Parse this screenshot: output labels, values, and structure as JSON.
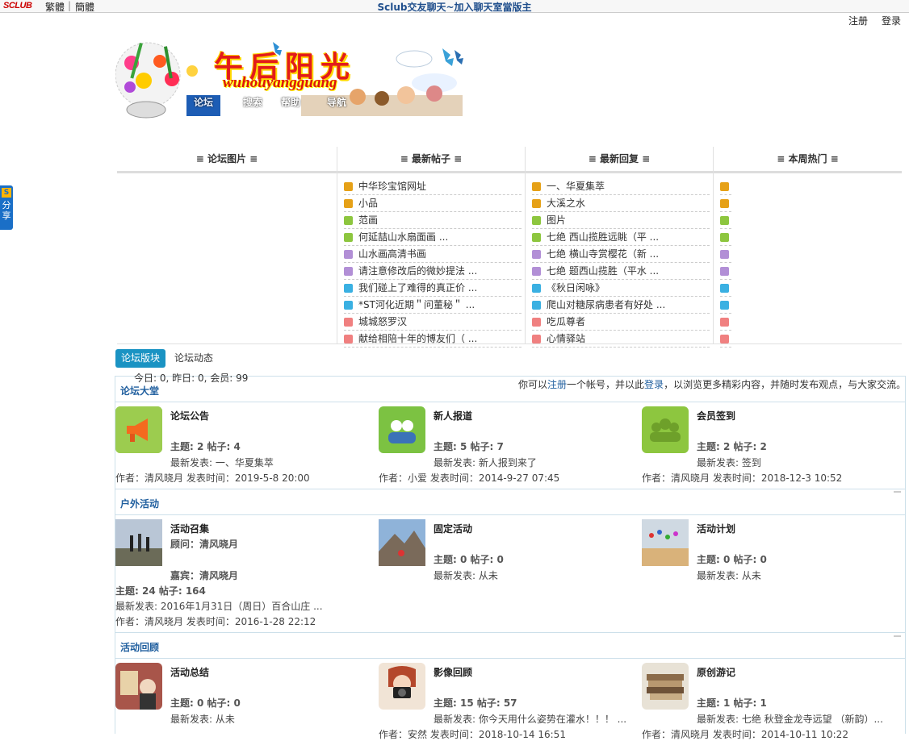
{
  "topbar": {
    "logo_text": "SCLUB",
    "traditional": "繁體",
    "separator": "|",
    "simplified": "簡體",
    "site_title": "Sclub交友聊天~加入聊天室當版主",
    "register": "注册",
    "login": "登录"
  },
  "banner": {
    "name": "午后阳光",
    "subtitle": "wuhouyangguang",
    "nav": [
      "论坛",
      "搜索",
      "帮助",
      "导航"
    ]
  },
  "share": {
    "badge": "S",
    "label": "分享"
  },
  "hot": {
    "columns": [
      {
        "title": "≡ 论坛图片 ≡",
        "items": []
      },
      {
        "title": "≡ 最新帖子 ≡",
        "items": [
          "中华珍宝馆网址",
          "小品",
          "范画",
          "何延喆山水扇面画 ...",
          "山水画高清书画",
          "请注意修改后的微妙提法 ...",
          "我们碰上了难得的真正价 ...",
          "*ST河化近期＂问董秘＂ ...",
          "城城怒罗汉",
          "献给相陪十年的博友们（ ..."
        ]
      },
      {
        "title": "≡ 最新回复 ≡",
        "items": [
          "一、华夏集萃",
          "大溪之水",
          "图片",
          "七绝 西山揽胜远眺（平 ...",
          "七绝 横山寺赏樱花（新 ...",
          "七绝 题西山揽胜（平水 ...",
          "《秋日闲咏》",
          "爬山对糖尿病患者有好处 ...",
          "吃瓜尊者",
          "心情驿站"
        ]
      },
      {
        "title": "≡ 本周热门 ≡",
        "items": [
          "",
          "",
          "",
          "",
          "",
          "",
          "",
          "",
          "",
          ""
        ]
      }
    ]
  },
  "forum_tabs": {
    "active": "论坛版块",
    "other": "论坛动态"
  },
  "stats": "今日: 0, 昨日: 0, 会员: 99",
  "welcome": {
    "pre": "你可以",
    "register": "注册",
    "mid": "一个帐号，并以此",
    "login": "登录",
    "post": "，以浏览更多精彩内容，并随时发布观点，与大家交流。"
  },
  "sections": [
    {
      "title": "论坛大堂",
      "forums": [
        {
          "name": "论坛公告",
          "stat": "主题: 2 帖子: 4",
          "latest": "最新发表: 一、华夏集萃",
          "meta": "作者：清风晓月   发表时间：2019-5-8 20:00",
          "icon": "megaphone-icon"
        },
        {
          "name": "新人报道",
          "stat": "主题: 5 帖子: 7",
          "latest": "最新发表: 新人报到来了",
          "meta": "作者：小爱   发表时间：2014-9-27 07:45",
          "icon": "users-icon"
        },
        {
          "name": "会员签到",
          "stat": "主题: 2 帖子: 2",
          "latest": "最新发表: 签到",
          "meta": "作者：清风晓月   发表时间：2018-12-3 10:52",
          "icon": "group-icon"
        }
      ]
    },
    {
      "title": "户外活动",
      "forums": [
        {
          "name": "活动召集",
          "advisor": "顾问：清风晓月",
          "guest": "嘉宾：清风晓月",
          "stat": "主题: 24 帖子: 164",
          "latest": "最新发表: 2016年1月31日（周日）百合山庄 ...",
          "meta": "作者：清风晓月   发表时间：2016-1-28 22:12",
          "icon": "hikers-photo-icon"
        },
        {
          "name": "固定活动",
          "stat": "主题: 0 帖子: 0",
          "latest": "最新发表: 从未",
          "icon": "mountain-photo-icon"
        },
        {
          "name": "活动计划",
          "stat": "主题: 0 帖子: 0",
          "latest": "最新发表: 从未",
          "icon": "jumping-photo-icon"
        }
      ]
    },
    {
      "title": "活动回顾",
      "forums": [
        {
          "name": "活动总结",
          "stat": "主题: 0 帖子: 0",
          "latest": "最新发表: 从未",
          "icon": "reading-photo-icon"
        },
        {
          "name": "影像回顾",
          "stat": "主题: 15 帖子: 57",
          "latest": "最新发表: 你今天用什么姿势在灌水！！！ ...",
          "meta": "作者：安然   发表时间：2018-10-14 16:51",
          "icon": "camera-photo-icon"
        },
        {
          "name": "原创游记",
          "stat": "主题: 1 帖子: 1",
          "latest": "最新发表: 七绝 秋登金龙寺远望 （新韵）...",
          "meta": "作者：清风晓月   发表时间：2014-10-11 10:22",
          "icon": "books-photo-icon"
        }
      ]
    }
  ]
}
